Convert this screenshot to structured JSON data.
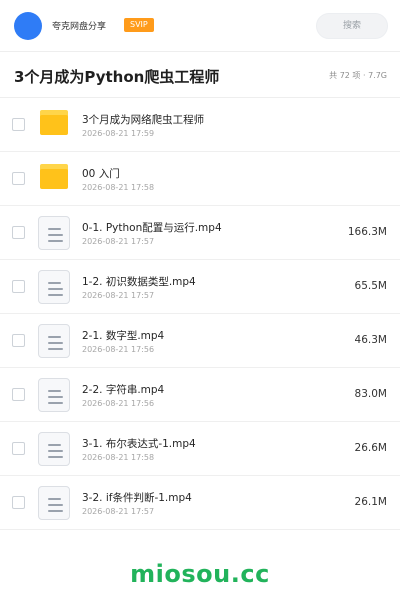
{
  "header": {
    "share_name": "夸克网盘分享",
    "vip_label": "SVIP",
    "search_placeholder": "搜索"
  },
  "folder": {
    "title": "3个月成为Python爬虫工程师",
    "summary": "共 72 项 · 7.7G"
  },
  "files": [
    {
      "type": "folder",
      "name": "3个月成为网络爬虫工程师",
      "date": "2026-08-21 17:59",
      "size": ""
    },
    {
      "type": "folder",
      "name": "00 入门",
      "date": "2026-08-21 17:58",
      "size": ""
    },
    {
      "type": "file",
      "name": "0-1. Python配置与运行.mp4",
      "date": "2026-08-21 17:57",
      "size": "166.3M"
    },
    {
      "type": "file",
      "name": "1-2. 初识数据类型.mp4",
      "date": "2026-08-21 17:57",
      "size": "65.5M"
    },
    {
      "type": "file",
      "name": "2-1. 数字型.mp4",
      "date": "2026-08-21 17:56",
      "size": "46.3M"
    },
    {
      "type": "file",
      "name": "2-2. 字符串.mp4",
      "date": "2026-08-21 17:56",
      "size": "83.0M"
    },
    {
      "type": "file",
      "name": "3-1. 布尔表达式-1.mp4",
      "date": "2026-08-21 17:58",
      "size": "26.6M"
    },
    {
      "type": "file",
      "name": "3-2. if条件判断-1.mp4",
      "date": "2026-08-21 17:57",
      "size": "26.1M"
    }
  ],
  "watermark": "miosou.cc",
  "colors": {
    "avatar": "#2f7cf6",
    "vip_badge": "#ff9b1a",
    "folder_icon": "#ffc21a",
    "watermark": "#22b35b"
  }
}
